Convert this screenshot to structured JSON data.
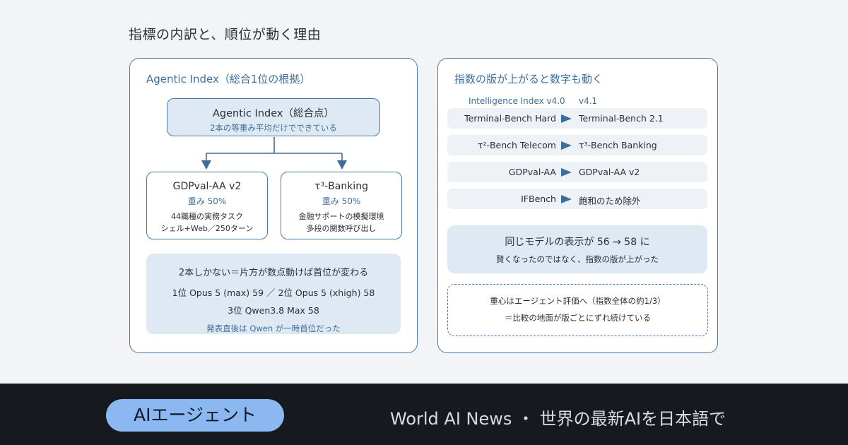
{
  "page_title": "指標の内訳と、順位が動く理由",
  "left_panel": {
    "heading": "Agentic Index（総合1位の根拠）",
    "top_box": {
      "title": "Agentic Index（総合点）",
      "subtitle": "2本の等重み平均だけでできている"
    },
    "sub_boxes": [
      {
        "title": "GDPval-AA v2",
        "weight": "重み 50%",
        "desc1": "44職種の実務タスク",
        "desc2": "シェル+Web／250ターン"
      },
      {
        "title": "τ³-Banking",
        "weight": "重み 50%",
        "desc1": "金融サポートの模擬環境",
        "desc2": "多段の関数呼び出し"
      }
    ],
    "summary": {
      "line1": "2本しかない＝片方が数点動けば首位が変わる",
      "line2": "1位 Opus 5 (max) 59 ／ 2位 Opus 5 (xhigh) 58",
      "line3": "3位 Qwen3.8 Max 58",
      "line4": "発表直後は Qwen が一時首位だった"
    }
  },
  "right_panel": {
    "heading": "指数の版が上がると数字も動く",
    "col_from": "Intelligence Index v4.0",
    "col_to": "v4.1",
    "rows": [
      {
        "from": "Terminal-Bench Hard",
        "to": "Terminal-Bench 2.1"
      },
      {
        "from": "τ²-Bench Telecom",
        "to": "τ³-Bench Banking"
      },
      {
        "from": "GDPval-AA",
        "to": "GDPval-AA v2"
      },
      {
        "from": "IFBench",
        "to": "飽和のため除外"
      }
    ],
    "note": {
      "line1": "同じモデルの表示が 56 → 58 に",
      "line2": "賢くなったのではなく、指数の版が上がった"
    },
    "dashed_note": {
      "line1": "重心はエージェント評価へ（指数全体の約1/3）",
      "line2": "＝比較の地面が版ごとにずれ続けている"
    }
  },
  "footer": {
    "category": "AIエージェント",
    "tagline": "World AI News ・ 世界の最新AIを日本語で"
  },
  "colors": {
    "accent": "#3e6f9c",
    "box_fill": "#dfe9f3",
    "pill": "#8cb8f2",
    "footer_bg": "#16191e"
  },
  "icons": {
    "row_arrow": "right-triangle-arrow",
    "connector": "down-arrow"
  }
}
